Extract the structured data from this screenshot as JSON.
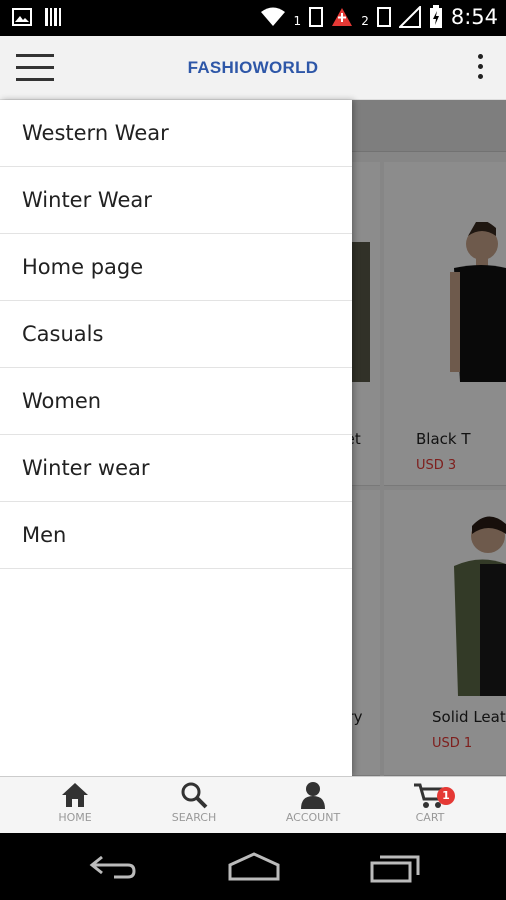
{
  "status_bar": {
    "time": "8:54",
    "sim1": "1",
    "sim2": "2",
    "icons": [
      "image-icon",
      "barcode-icon",
      "wifi-icon",
      "sim-icon",
      "alert-icon",
      "signal-icon",
      "battery-icon"
    ]
  },
  "app_bar": {
    "title": "FASHIOWORLD",
    "menu_icon": "hamburger-icon",
    "overflow_icon": "more-vert-icon"
  },
  "drawer": {
    "items": [
      {
        "label": "Western Wear"
      },
      {
        "label": "Winter Wear"
      },
      {
        "label": "Home page"
      },
      {
        "label": "Casuals"
      },
      {
        "label": "Women"
      },
      {
        "label": "Winter wear"
      },
      {
        "label": "Men"
      }
    ]
  },
  "background_products": [
    {
      "label": "cket",
      "price": ""
    },
    {
      "label": "Black T",
      "price": "USD 3"
    },
    {
      "label": "ry",
      "price": ""
    },
    {
      "label": "Solid Leatl",
      "price": "USD 1"
    }
  ],
  "bottom_nav": {
    "items": [
      {
        "label": "HOME",
        "icon": "home-icon"
      },
      {
        "label": "SEARCH",
        "icon": "search-icon"
      },
      {
        "label": "ACCOUNT",
        "icon": "account-icon"
      },
      {
        "label": "CART",
        "icon": "cart-icon",
        "badge": "1"
      }
    ]
  },
  "colors": {
    "title": "#2e57a8",
    "badge": "#e53935",
    "price": "#e53935"
  }
}
